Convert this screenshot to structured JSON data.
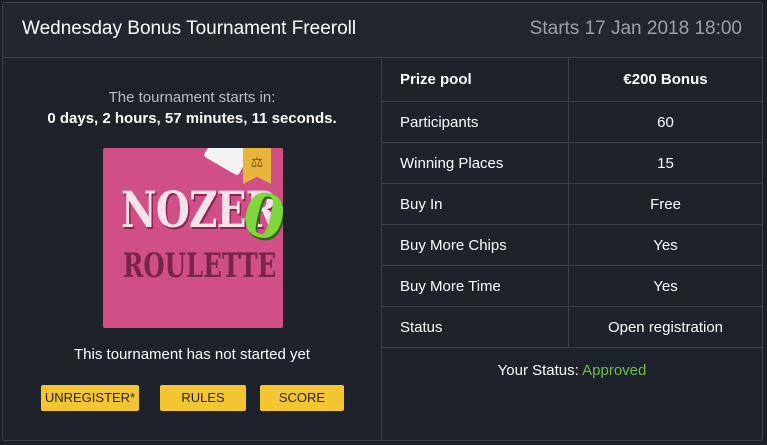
{
  "header": {
    "title": "Wednesday Bonus Tournament Freeroll",
    "starts": "Starts 17 Jan 2018 18:00"
  },
  "countdown": {
    "label": "The tournament starts in:",
    "value": "0 days, 2 hours, 57 minutes, 11 seconds."
  },
  "game_image": {
    "line1": "NOZER",
    "accent": "0",
    "line2": "ROULETTE",
    "badge_icon": "scales-icon"
  },
  "status_message": "This tournament has not started yet",
  "buttons": {
    "unregister": "UNREGISTER*",
    "rules": "RULES",
    "score": "SCORE"
  },
  "prize": {
    "label": "Prize pool",
    "value": "€200 Bonus"
  },
  "details": [
    {
      "key": "Participants",
      "value": "60"
    },
    {
      "key": "Winning Places",
      "value": "15"
    },
    {
      "key": "Buy In",
      "value": "Free"
    },
    {
      "key": "Buy More Chips",
      "value": "Yes"
    },
    {
      "key": "Buy More Time",
      "value": "Yes"
    },
    {
      "key": "Status",
      "value": "Open registration"
    }
  ],
  "your_status": {
    "label": "Your Status: ",
    "value": "Approved"
  },
  "colors": {
    "accent_yellow": "#f3c531",
    "approved_green": "#6bbf4a",
    "background": "#1d222b"
  }
}
